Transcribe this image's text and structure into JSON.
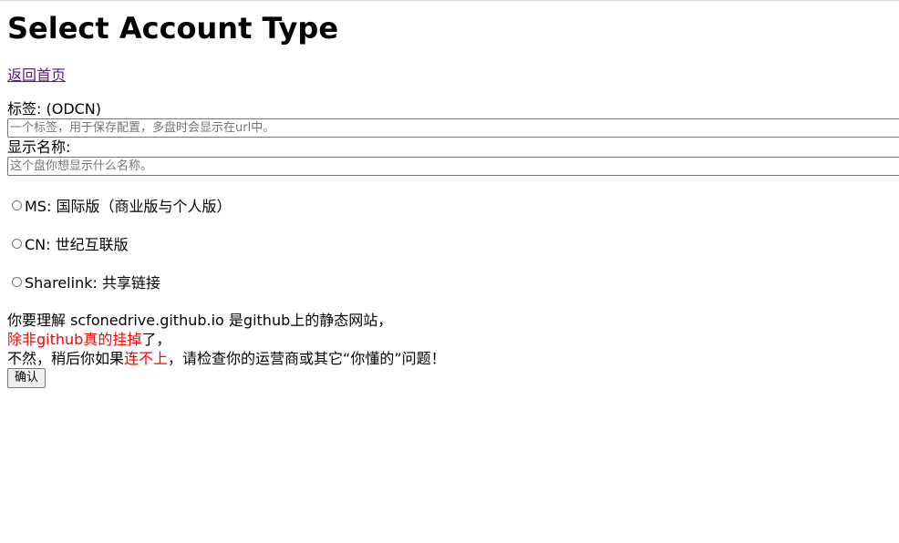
{
  "page": {
    "title": "Select Account Type",
    "home_link": "返回首页"
  },
  "form": {
    "tag_label": "标签: (ODCN)",
    "tag_placeholder": "一个标签，用于保存配置，多盘时会显示在url中。",
    "tag_value": "",
    "name_label": "显示名称:",
    "name_placeholder": "这个盘你想显示什么名称。",
    "name_value": "",
    "options": [
      {
        "label": "MS: 国际版（商业版与个人版）",
        "selected": false
      },
      {
        "label": "CN: 世纪互联版",
        "selected": false
      },
      {
        "label": "Sharelink: 共享链接",
        "selected": false
      }
    ]
  },
  "notice": {
    "line1": "你要理解 scfonedrive.github.io 是github上的静态网站，",
    "line2_red": "除非github真的挂掉",
    "line2_tail": "了，",
    "line3_pre": "不然，稍后你如果",
    "line3_red": "连不上",
    "line3_post": "，请检查你的运营商或其它“你懂的”问题！"
  },
  "buttons": {
    "confirm": "确认"
  },
  "colors": {
    "link_visited": "#551a8b",
    "warning_red": "#ff0000",
    "button_bg": "#efefef",
    "border": "#767676"
  }
}
